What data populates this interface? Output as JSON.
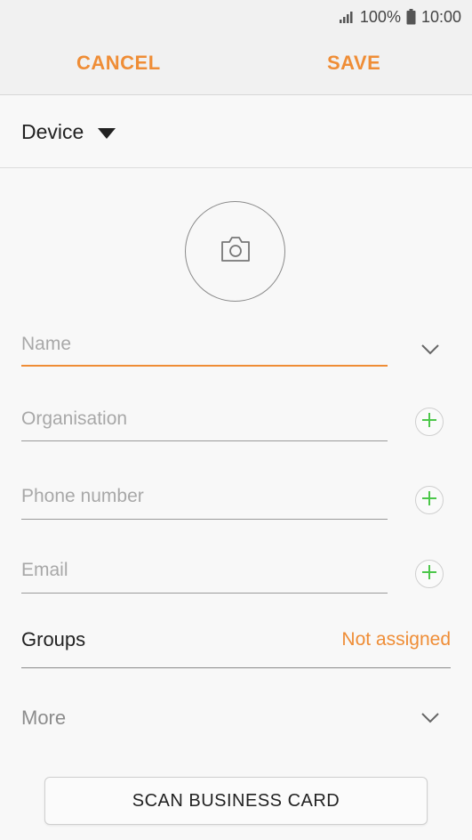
{
  "status_bar": {
    "battery": "100%",
    "time": "10:00"
  },
  "action_bar": {
    "cancel_label": "CANCEL",
    "save_label": "SAVE"
  },
  "storage": {
    "label": "Device"
  },
  "form": {
    "name_placeholder": "Name",
    "organisation_placeholder": "Organisation",
    "phone_placeholder": "Phone number",
    "email_placeholder": "Email",
    "groups_label": "Groups",
    "groups_value": "Not assigned",
    "more_label": "More",
    "scan_button_label": "SCAN BUSINESS CARD"
  },
  "colors": {
    "accent": "#ef8d36",
    "plus_green": "#4cc74a"
  }
}
